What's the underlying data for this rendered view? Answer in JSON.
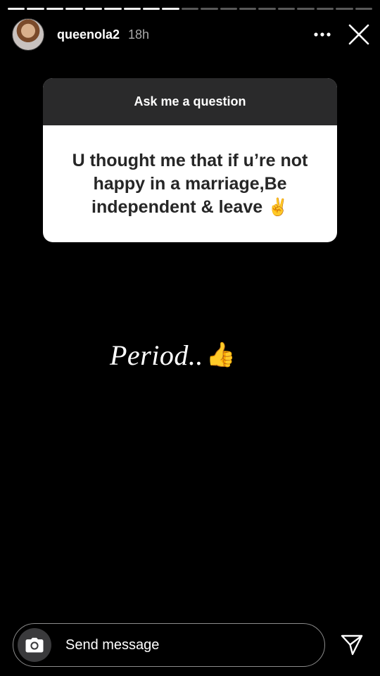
{
  "story": {
    "segments_total": 19,
    "segments_viewed": 9
  },
  "header": {
    "username": "queenola2",
    "time": "18h",
    "more_icon": "more-horizontal-icon",
    "close_icon": "close-icon"
  },
  "question_sticker": {
    "title": "Ask me a question",
    "question": "U thought me that if u’re not happy in a marriage,Be independent & leave",
    "emoji": "✌️"
  },
  "caption": {
    "text": "Period..",
    "emoji": "👍"
  },
  "bottom_bar": {
    "camera_icon": "camera-icon",
    "message_placeholder": "Send message",
    "send_icon": "send-icon"
  },
  "colors": {
    "background": "#000000",
    "sticker_header": "#2a2a2b",
    "sticker_body": "#ffffff",
    "sticker_text": "#262626",
    "timestamp": "#a9a9a9"
  }
}
